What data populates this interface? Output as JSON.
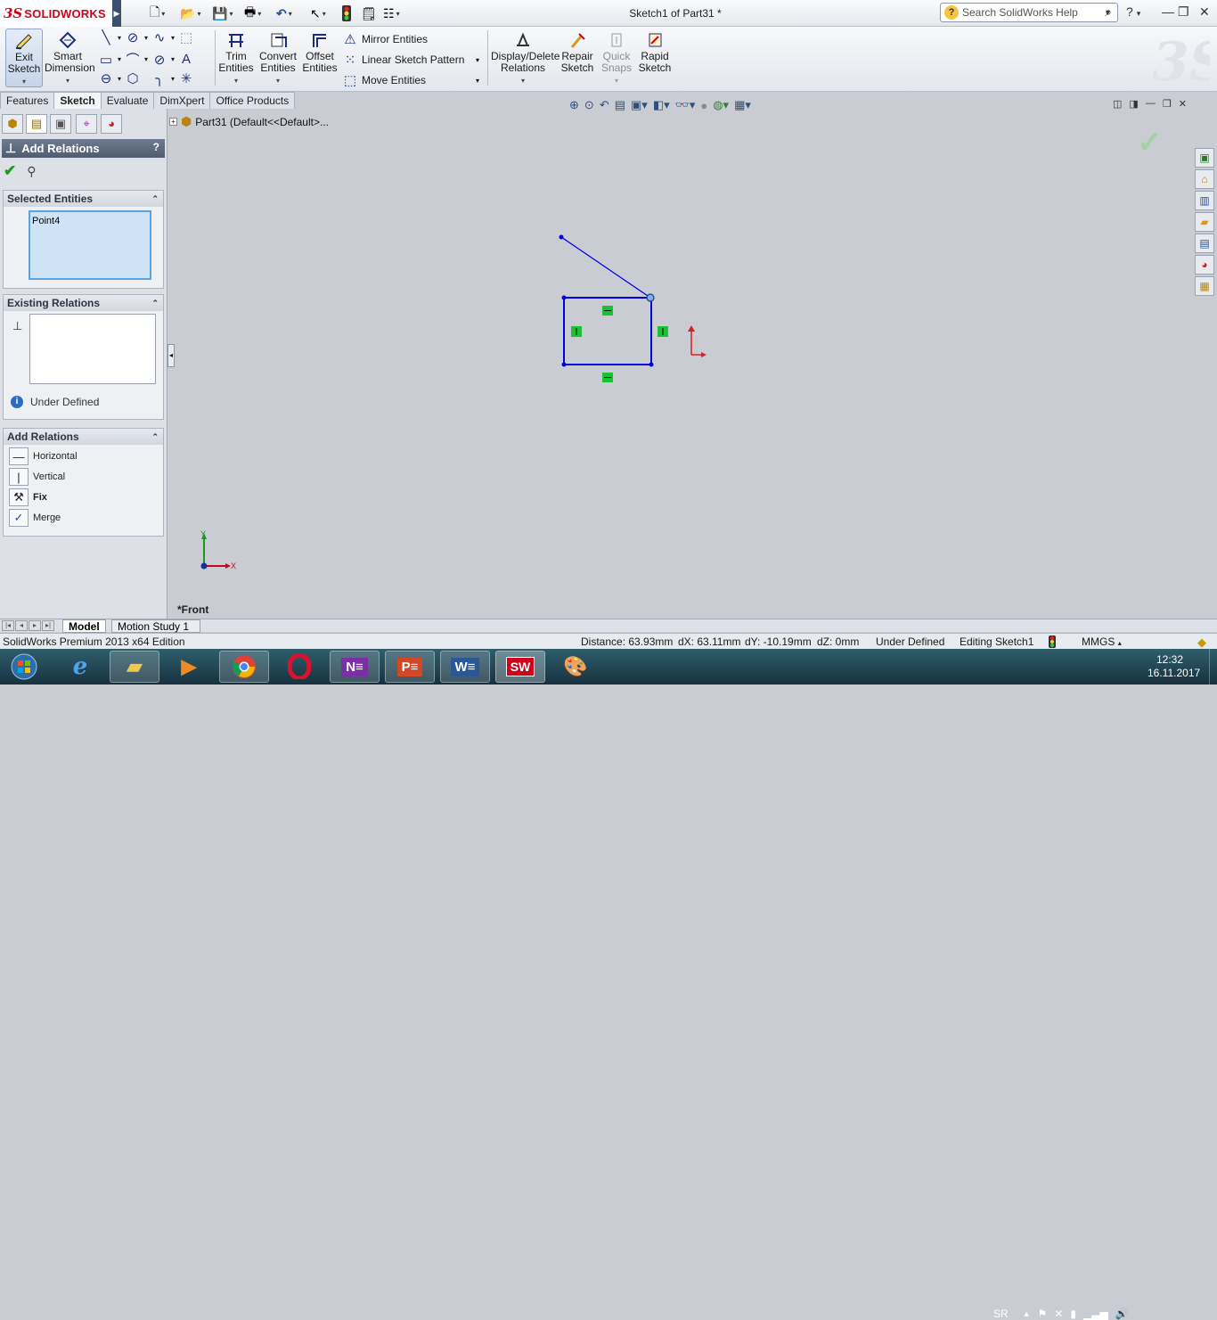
{
  "titlebar": {
    "brand_ds": "3S",
    "brand_name": "SOLIDWORKS",
    "document_title": "Sketch1 of Part31 *",
    "search_placeholder": "Search SolidWorks Help",
    "help_symbol": "?"
  },
  "toolbar": {
    "exit_sketch": "Exit Sketch",
    "smart_dimension": "Smart Dimension",
    "trim_entities": "Trim Entities",
    "convert_entities": "Convert Entities",
    "offset_entities": "Offset Entities",
    "mirror_entities": "Mirror Entities",
    "linear_sketch_pattern": "Linear Sketch Pattern",
    "move_entities": "Move Entities",
    "display_delete_relations": "Display/Delete Relations",
    "repair_sketch": "Repair Sketch",
    "quick_snaps": "Quick Snaps",
    "rapid_sketch": "Rapid Sketch"
  },
  "tabs": [
    {
      "label": "Features",
      "active": false
    },
    {
      "label": "Sketch",
      "active": true
    },
    {
      "label": "Evaluate",
      "active": false
    },
    {
      "label": "DimXpert",
      "active": false
    },
    {
      "label": "Office Products",
      "active": false
    }
  ],
  "property_manager": {
    "title": "Add Relations",
    "help": "?",
    "selected_entities": {
      "heading": "Selected Entities",
      "items": [
        "Point4"
      ]
    },
    "existing_relations": {
      "heading": "Existing Relations",
      "status": "Under Defined"
    },
    "add_relations": {
      "heading": "Add Relations",
      "items": [
        {
          "label": "Horizontal",
          "icon": "horizontal-relation-icon",
          "bold": false
        },
        {
          "label": "Vertical",
          "icon": "vertical-relation-icon",
          "bold": false
        },
        {
          "label": "Fix",
          "icon": "fix-relation-icon",
          "bold": true
        },
        {
          "label": "Merge",
          "icon": "merge-relation-icon",
          "bold": false
        }
      ]
    }
  },
  "feature_tree": {
    "root_label": "Part31  (Default<<Default>..."
  },
  "viewport": {
    "view_name": "*Front",
    "axis_y": "Y",
    "axis_x": "X"
  },
  "bottom_tabs": [
    {
      "label": "Model",
      "active": true
    },
    {
      "label": "Motion Study 1",
      "active": false
    }
  ],
  "statusbar": {
    "edition": "SolidWorks Premium 2013 x64 Edition",
    "distance": "Distance: 63.93mm",
    "dx": "dX: 63.11mm",
    "dy": "dY: -10.19mm",
    "dz": "dZ: 0mm",
    "definition": "Under Defined",
    "editing": "Editing Sketch1",
    "units": "MMGS"
  },
  "taskbar": {
    "language": "SR",
    "time": "12:32",
    "date": "16.11.2017",
    "apps": [
      "Start",
      "Internet Explorer",
      "File Explorer",
      "Media Player",
      "Chrome",
      "Opera",
      "OneNote",
      "PowerPoint",
      "Word",
      "SolidWorks",
      "Paint"
    ]
  },
  "colors": {
    "sketch_blue": "#0000e6",
    "relation_green": "#19c232",
    "origin_red": "#e11b1b",
    "header_slate": "#5b6779"
  }
}
